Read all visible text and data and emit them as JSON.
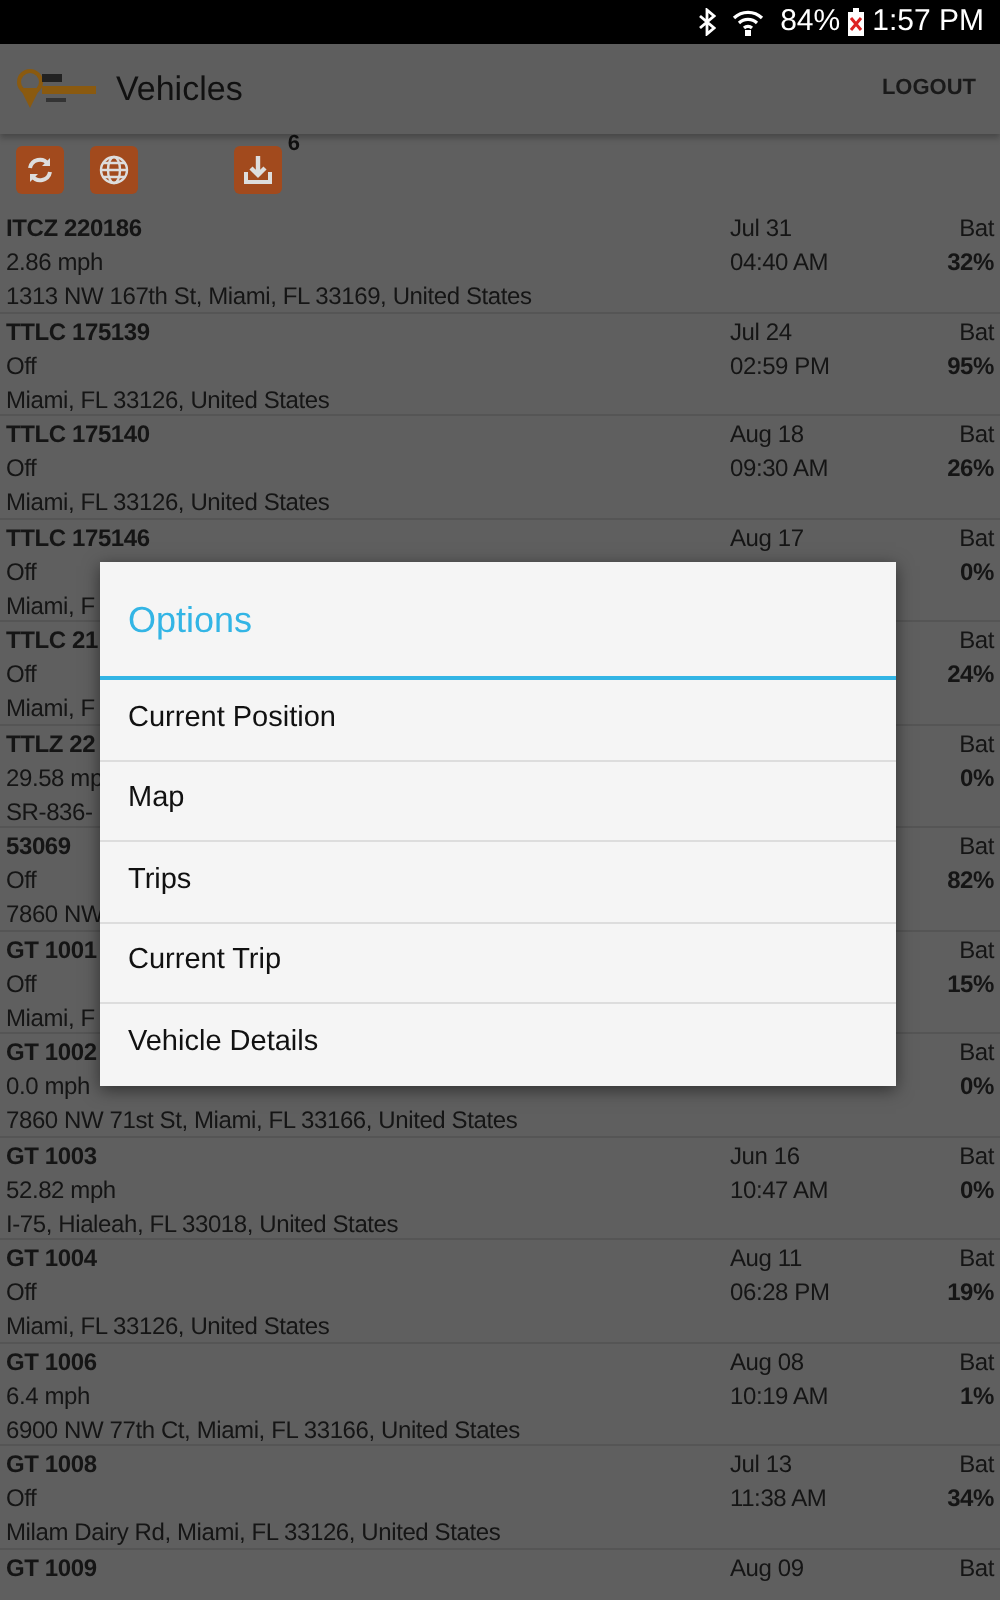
{
  "status_bar": {
    "battery_text": "84%",
    "time": "1:57 PM"
  },
  "app_bar": {
    "title": "Vehicles",
    "action": "LOGOUT"
  },
  "toolbar": [
    {
      "kind": "refresh"
    },
    {
      "kind": "globe"
    },
    {
      "kind": "download",
      "count": "6"
    }
  ],
  "vehicles": [
    {
      "name": "ITCZ 220186",
      "speed": "2.86 mph",
      "address": "1313 NW 167th St, Miami, FL 33169, United States",
      "date": "Jul 31",
      "time": "04:40 AM",
      "bat_label": "Bat",
      "battery": "32%"
    },
    {
      "name": "TTLC 175139",
      "speed": "Off",
      "address": "Miami, FL 33126, United States",
      "date": "Jul 24",
      "time": "02:59 PM",
      "bat_label": "Bat",
      "battery": "95%"
    },
    {
      "name": "TTLC 175140",
      "speed": "Off",
      "address": "Miami, FL 33126, United States",
      "date": "Aug 18",
      "time": "09:30 AM",
      "bat_label": "Bat",
      "battery": "26%"
    },
    {
      "name": "TTLC 175146",
      "speed": "Off",
      "address": "Miami, F",
      "date": "Aug 17",
      "bat_label": "Bat",
      "battery": "0%"
    },
    {
      "name": "TTLC 21",
      "speed": "Off",
      "address": "Miami, F",
      "bat_label": "Bat",
      "battery": "24%"
    },
    {
      "name": "TTLZ 22",
      "speed": "29.58 mp",
      "address": "SR-836-",
      "bat_label": "Bat",
      "battery": "0%"
    },
    {
      "name": "53069",
      "speed": "Off",
      "address": "7860 NW",
      "bat_label": "Bat",
      "battery": "82%"
    },
    {
      "name": "GT 1001",
      "speed": "Off",
      "address": "Miami, F",
      "bat_label": "Bat",
      "battery": "15%"
    },
    {
      "name": "GT 1002",
      "speed": "0.0 mph",
      "address": "7860 NW 71st St, Miami, FL 33166, United States",
      "bat_label": "Bat",
      "battery": "0%"
    },
    {
      "name": "GT 1003",
      "speed": "52.82 mph",
      "address": "I-75, Hialeah, FL 33018, United States",
      "date": "Jun 16",
      "time": "10:47 AM",
      "bat_label": "Bat",
      "battery": "0%"
    },
    {
      "name": "GT 1004",
      "speed": "Off",
      "address": "Miami, FL 33126, United States",
      "date": "Aug 11",
      "time": "06:28 PM",
      "bat_label": "Bat",
      "battery": "19%"
    },
    {
      "name": "GT 1006",
      "speed": "6.4 mph",
      "address": "6900 NW 77th Ct, Miami, FL 33166, United States",
      "date": "Aug 08",
      "time": "10:19 AM",
      "bat_label": "Bat",
      "battery": "1%"
    },
    {
      "name": "GT 1008",
      "speed": "Off",
      "address": "Milam Dairy Rd, Miami, FL 33126, United States",
      "date": "Jul 13",
      "time": "11:38 AM",
      "bat_label": "Bat",
      "battery": "34%"
    },
    {
      "name": "GT 1009",
      "date": "Aug 09",
      "bat_label": "Bat"
    }
  ],
  "dialog": {
    "title": "Options",
    "items": [
      "Current Position",
      "Map",
      "Trips",
      "Current Trip",
      "Vehicle Details"
    ]
  }
}
